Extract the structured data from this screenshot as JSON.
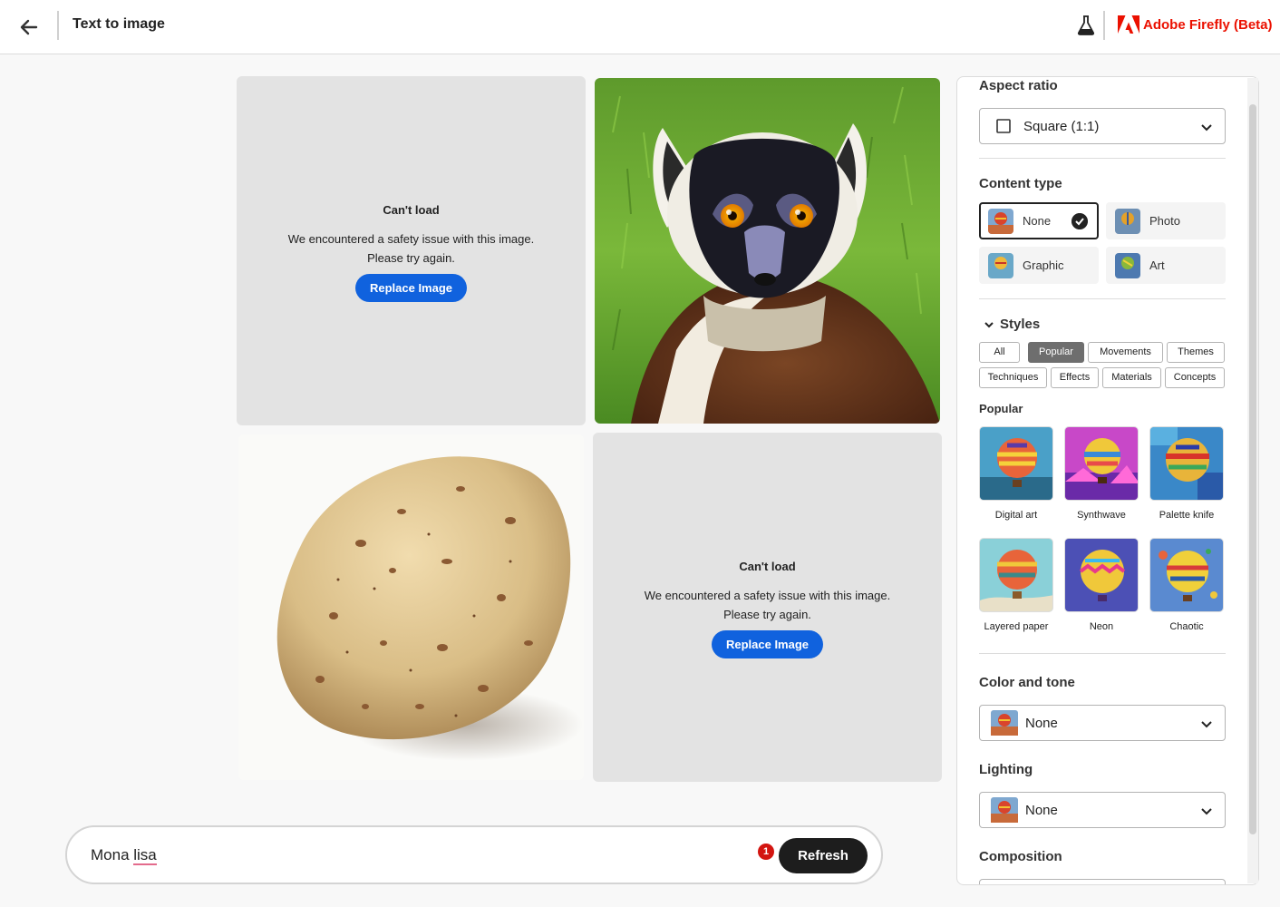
{
  "header": {
    "title": "Text to image",
    "brand": "Adobe Firefly (Beta)",
    "brand_color": "#eb1000"
  },
  "grid": {
    "failed_tiles": [
      {
        "title": "Can't load",
        "line1": "We encountered a safety issue with this image.",
        "line2": "Please try again.",
        "button": "Replace Image"
      },
      {
        "title": "Can't load",
        "line1": "We encountered a safety issue with this image.",
        "line2": "Please try again.",
        "button": "Replace Image"
      }
    ],
    "images": [
      "lemur-image",
      "potato-image"
    ]
  },
  "prompt": {
    "text_plain": "Mona ",
    "text_flagged": "lisa",
    "error_count": "1",
    "refresh_label": "Refresh"
  },
  "panel": {
    "aspect_ratio": {
      "label": "Aspect ratio",
      "value": "Square (1:1)"
    },
    "content_type": {
      "label": "Content type",
      "options": [
        "None",
        "Photo",
        "Graphic",
        "Art"
      ],
      "selected": "None"
    },
    "styles": {
      "label": "Styles",
      "chips": [
        "All",
        "Popular",
        "Movements",
        "Themes",
        "Techniques",
        "Effects",
        "Materials",
        "Concepts"
      ],
      "active_chip": "Popular",
      "section_label": "Popular",
      "items": [
        "Digital art",
        "Synthwave",
        "Palette knife",
        "Layered paper",
        "Neon",
        "Chaotic"
      ]
    },
    "color_and_tone": {
      "label": "Color and tone",
      "value": "None"
    },
    "lighting": {
      "label": "Lighting",
      "value": "None"
    },
    "composition": {
      "label": "Composition"
    }
  },
  "colors": {
    "accent_blue": "#1062de",
    "error_red": "#d31510"
  }
}
